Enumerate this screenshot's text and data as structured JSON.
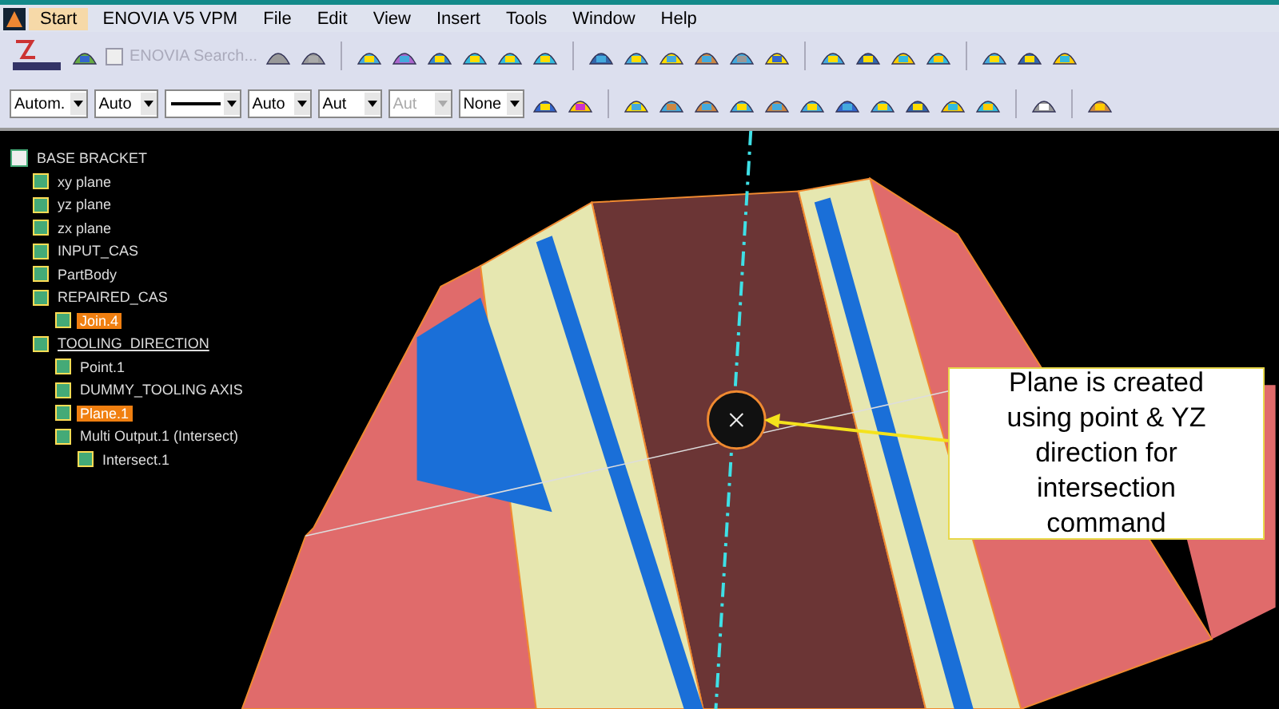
{
  "menu": [
    {
      "label": "Start",
      "selected": true
    },
    {
      "label": "ENOVIA V5 VPM",
      "selected": false
    },
    {
      "label": "File",
      "selected": false
    },
    {
      "label": "Edit",
      "selected": false
    },
    {
      "label": "View",
      "selected": false
    },
    {
      "label": "Insert",
      "selected": false
    },
    {
      "label": "Tools",
      "selected": false
    },
    {
      "label": "Window",
      "selected": false
    },
    {
      "label": "Help",
      "selected": false
    }
  ],
  "search": {
    "label": "ENOVIA Search...",
    "checked": false,
    "disabled": true
  },
  "dropdowns": [
    {
      "kind": "text",
      "value": "Autom.",
      "disabled": false
    },
    {
      "kind": "text",
      "value": "Auto",
      "disabled": false
    },
    {
      "kind": "line",
      "disabled": false
    },
    {
      "kind": "text",
      "value": "Auto",
      "disabled": false
    },
    {
      "kind": "text",
      "value": "Aut",
      "disabled": false
    },
    {
      "kind": "text",
      "value": "Aut",
      "disabled": true
    },
    {
      "kind": "text",
      "value": "None",
      "disabled": false
    }
  ],
  "tree": {
    "label": "BASE BRACKET",
    "children": [
      {
        "label": "xy plane",
        "highlighted": false,
        "current": false
      },
      {
        "label": "yz plane",
        "highlighted": false,
        "current": false
      },
      {
        "label": "zx plane",
        "highlighted": false,
        "current": false
      },
      {
        "label": "INPUT_CAS",
        "highlighted": false,
        "current": false
      },
      {
        "label": "PartBody",
        "highlighted": false,
        "current": false
      },
      {
        "label": "REPAIRED_CAS",
        "highlighted": false,
        "current": false,
        "children": [
          {
            "label": "Join.4",
            "highlighted": true,
            "current": false
          }
        ]
      },
      {
        "label": "TOOLING_DIRECTION",
        "highlighted": false,
        "current": true,
        "children": [
          {
            "label": "Point.1",
            "highlighted": false,
            "current": false
          },
          {
            "label": "DUMMY_TOOLING AXIS",
            "highlighted": false,
            "current": false
          },
          {
            "label": "Plane.1",
            "highlighted": true,
            "current": false
          },
          {
            "label": "Multi Output.1 (Intersect)",
            "highlighted": false,
            "current": false,
            "children": [
              {
                "label": "Intersect.1",
                "highlighted": false,
                "current": false
              }
            ]
          }
        ]
      }
    ]
  },
  "callout": {
    "text": "Plane is created using point & YZ direction for intersection command"
  }
}
